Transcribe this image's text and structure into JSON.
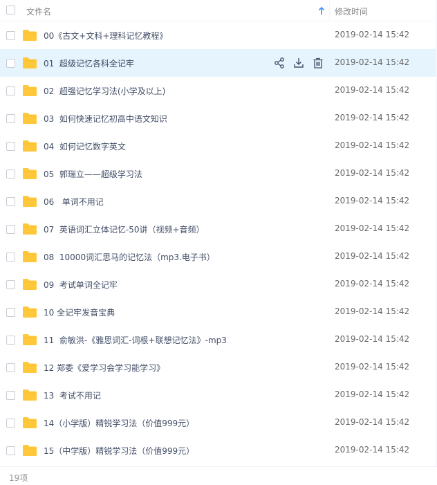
{
  "header": {
    "name_label": "文件名",
    "time_label": "修改时间",
    "sort_icon": "arrow-up-icon"
  },
  "colors": {
    "folder": "#ffc83a",
    "hover_row": "#e5f4fd",
    "sort_arrow": "#3b8cff",
    "text": "#424e67"
  },
  "rows": [
    {
      "name": "00《古文+文科+理科记忆教程》",
      "time": "2019-02-14 15:42"
    },
    {
      "name": "01  超级记忆各科全记牢",
      "time": "2019-02-14 15:42",
      "hovered": true
    },
    {
      "name": "02  超强记忆学习法(小学及以上)",
      "time": "2019-02-14 15:42"
    },
    {
      "name": "03  如何快速记忆初高中语文知识",
      "time": "2019-02-14 15:42"
    },
    {
      "name": "04  如何记忆数字英文",
      "time": "2019-02-14 15:42"
    },
    {
      "name": "05  郭瑞立——超级学习法",
      "time": "2019-02-14 15:42"
    },
    {
      "name": "06   单词不用记",
      "time": "2019-02-14 15:42"
    },
    {
      "name": "07  英语词汇立体记忆-50讲（视频+音频）",
      "time": "2019-02-14 15:42"
    },
    {
      "name": "08  10000词汇思马的记忆法（mp3.电子书）",
      "time": "2019-02-14 15:42"
    },
    {
      "name": "09  考试单词全记牢",
      "time": "2019-02-14 15:42"
    },
    {
      "name": "10 全记牢发音宝典",
      "time": "2019-02-14 15:42"
    },
    {
      "name": "11  俞敏洪-《雅思词汇-词根+联想记忆法》-mp3",
      "time": "2019-02-14 15:42"
    },
    {
      "name": "12 郑委《爱学习会学习能学习》",
      "time": "2019-02-14 15:42"
    },
    {
      "name": "13  考试不用记",
      "time": "2019-02-14 15:42"
    },
    {
      "name": "14（小学版）精锐学习法（价值999元）",
      "time": "2019-02-14 15:42"
    },
    {
      "name": "15（中学版）精锐学习法（价值999元）",
      "time": "2019-02-14 15:42"
    }
  ],
  "row_actions": [
    "share-icon",
    "download-icon",
    "delete-icon"
  ],
  "footer": {
    "count": "19项"
  }
}
